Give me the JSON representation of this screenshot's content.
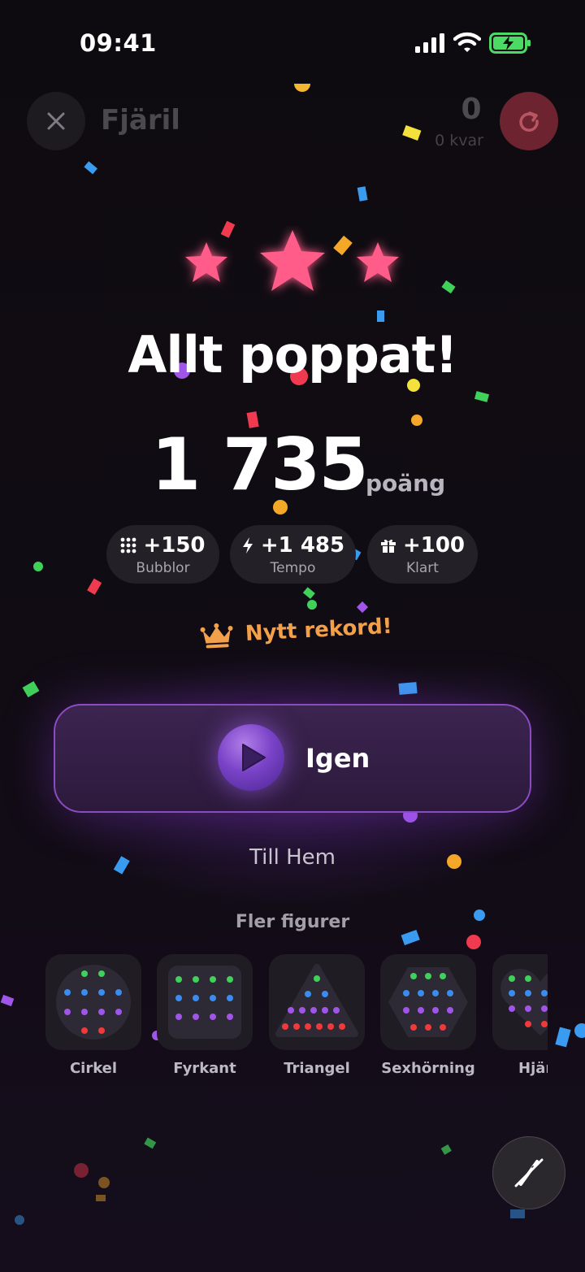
{
  "status_bar": {
    "time": "09:41"
  },
  "top_bar": {
    "title": "Fjäril",
    "remaining_count": "0",
    "remaining_label": "0 kvar"
  },
  "result": {
    "stars_earned": 3,
    "headline": "Allt poppat!",
    "score": "1 735",
    "score_unit": "poäng",
    "breakdown": [
      {
        "icon": "grid-dots-icon",
        "value": "+150",
        "label": "Bubblor"
      },
      {
        "icon": "lightning-icon",
        "value": "+1 485",
        "label": "Tempo"
      },
      {
        "icon": "gift-icon",
        "value": "+100",
        "label": "Klart"
      }
    ],
    "record_label": "Nytt rekord!"
  },
  "actions": {
    "again_label": "Igen",
    "home_label": "Till Hem"
  },
  "more_shapes": {
    "title": "Fler figurer",
    "items": [
      {
        "label": "Cirkel"
      },
      {
        "label": "Fyrkant"
      },
      {
        "label": "Triangel"
      },
      {
        "label": "Sexhörning"
      },
      {
        "label": "Hjär"
      }
    ]
  },
  "colors": {
    "star": "#ff5c8a",
    "record": "#f2a04a",
    "accent_purple": "#8a4cc0",
    "bubble_green": "#3fd15a",
    "bubble_blue": "#3a8cf0",
    "bubble_purple": "#a055e8",
    "bubble_red": "#f03a3a"
  }
}
